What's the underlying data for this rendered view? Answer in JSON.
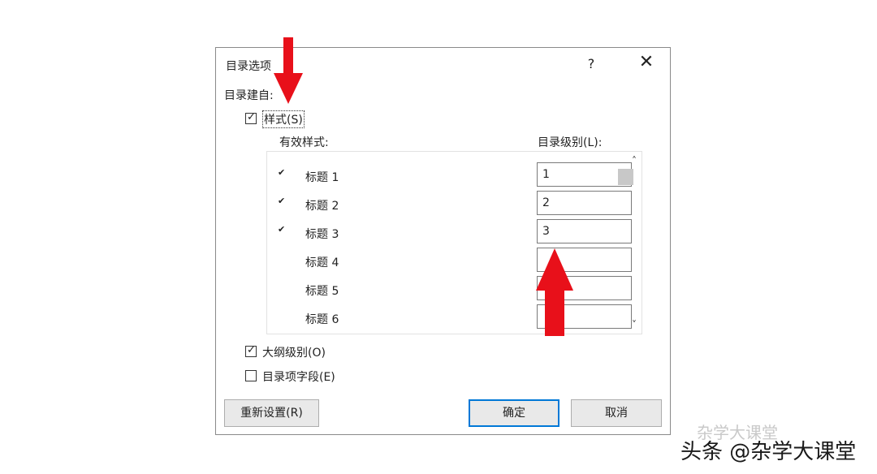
{
  "dialog": {
    "title": "目录选项",
    "help": "?",
    "close": "✕",
    "section_label": "目录建自:",
    "styles_checkbox": {
      "checked": true,
      "label": "样式(S)"
    },
    "col_styles": "有效样式:",
    "col_level": "目录级别(L):",
    "rows": [
      {
        "tick": "✔",
        "name": "标题 1",
        "level": "1"
      },
      {
        "tick": "✔",
        "name": "标题 2",
        "level": "2"
      },
      {
        "tick": "✔",
        "name": "标题 3",
        "level": "3"
      },
      {
        "tick": "",
        "name": "标题 4",
        "level": ""
      },
      {
        "tick": "",
        "name": "标题 5",
        "level": ""
      },
      {
        "tick": "",
        "name": "标题 6",
        "level": ""
      }
    ],
    "scroll_up": "˄",
    "scroll_down": "˅",
    "outline_checkbox": {
      "checked": true,
      "label": "大纲级别(O)"
    },
    "field_checkbox": {
      "checked": false,
      "label": "目录项字段(E)"
    },
    "reset_button": "重新设置(R)",
    "ok_button": "确定",
    "cancel_button": "取消",
    "check_mark": "✓"
  },
  "annotation": {
    "arrow_color": "#e8101a"
  },
  "watermark": {
    "line1": "杂学大课堂",
    "line2": "头条 @杂学大课堂"
  }
}
